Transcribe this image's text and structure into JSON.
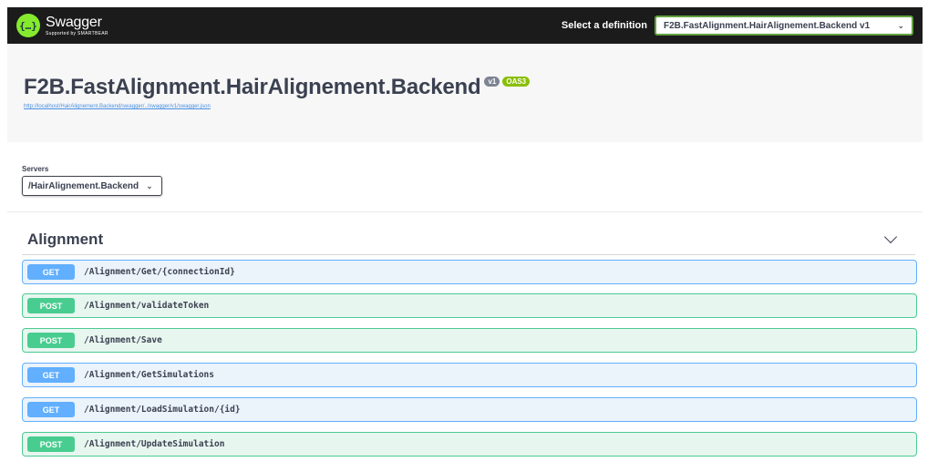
{
  "topbar": {
    "logo_glyph": "{…}",
    "logo_title": "Swagger",
    "logo_subtitle": "Supported by SMARTBEAR",
    "definition_label": "Select a definition",
    "definition_value": "F2B.FastAlignment.HairAlignement.Backend v1",
    "brand_color": "#85ea2d"
  },
  "info": {
    "title": "F2B.FastAlignment.HairAlignement.Backend",
    "version_badge": "v1",
    "oas_badge": "OAS3",
    "spec_url": "http://localhost/HairAlignement.Backend/swagger/../swagger/v1/swagger.json"
  },
  "servers": {
    "label": "Servers",
    "selected": "/HairAlignement.Backend"
  },
  "tag": {
    "name": "Alignment",
    "operations": [
      {
        "method": "GET",
        "path": "/Alignment/Get/{connectionId}"
      },
      {
        "method": "POST",
        "path": "/Alignment/validateToken"
      },
      {
        "method": "POST",
        "path": "/Alignment/Save"
      },
      {
        "method": "GET",
        "path": "/Alignment/GetSimulations"
      },
      {
        "method": "GET",
        "path": "/Alignment/LoadSimulation/{id}"
      },
      {
        "method": "POST",
        "path": "/Alignment/UpdateSimulation"
      }
    ]
  },
  "colors": {
    "get": "#61affe",
    "post": "#49cc90"
  }
}
